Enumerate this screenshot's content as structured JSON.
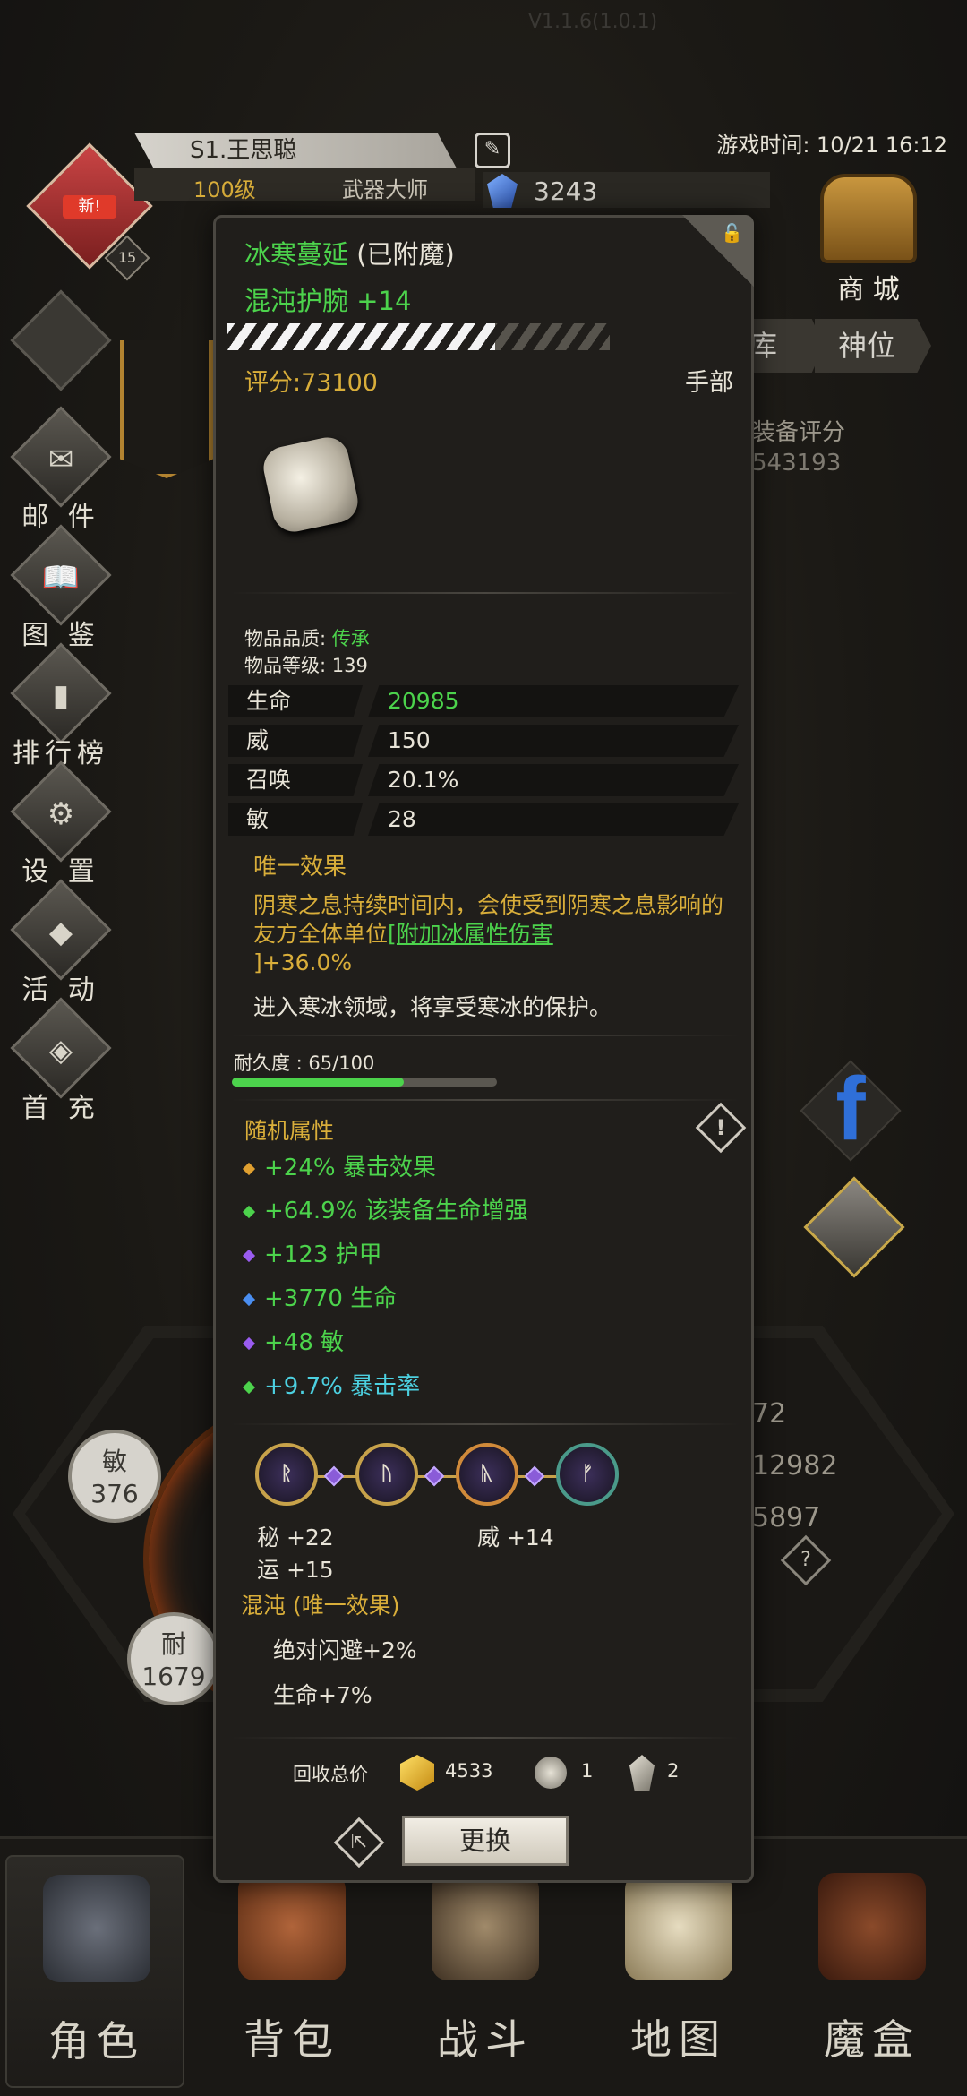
{
  "header": {
    "version": "V1.1.6(1.0.1)",
    "game_time": "游戏时间: 10/21 16:12",
    "avatar_badge": "新!",
    "avatar_level": "15",
    "player_name": "S1.王思聪",
    "player_level": "100级",
    "player_class": "武器大师",
    "gems": "3243",
    "shop_label": "商 城"
  },
  "right_tabs": [
    "库",
    "神位"
  ],
  "right_rating": {
    "label": "装备评分",
    "value": "543193"
  },
  "left_nav": [
    {
      "label": "邮 件",
      "icon": "mail-icon",
      "glyph": "✉"
    },
    {
      "label": "图 鉴",
      "icon": "book-icon",
      "glyph": "📖"
    },
    {
      "label": "排行榜",
      "icon": "leaderboard-icon",
      "glyph": "▮"
    },
    {
      "label": "设 置",
      "icon": "gear-icon",
      "glyph": "⚙"
    },
    {
      "label": "活 动",
      "icon": "event-icon",
      "glyph": "◆"
    },
    {
      "label": "首 充",
      "icon": "first-recharge-icon",
      "glyph": "◈"
    }
  ],
  "bg_stats": {
    "agility": {
      "label": "敏",
      "value": "376"
    },
    "durability": {
      "label": "耐",
      "value": "1679"
    },
    "right_values": [
      "72",
      "12982",
      "5897"
    ]
  },
  "bottom_nav": [
    {
      "label": "角色",
      "icon": "helmet-icon"
    },
    {
      "label": "背包",
      "icon": "backpack-icon"
    },
    {
      "label": "战斗",
      "icon": "sword-icon"
    },
    {
      "label": "地图",
      "icon": "scroll-map-icon"
    },
    {
      "label": "魔盒",
      "icon": "magic-box-icon"
    }
  ],
  "item": {
    "name": "冰寒蔓延",
    "name_suffix": "(已附魔)",
    "subtitle": "混沌护腕 +14",
    "enchant_progress": 0.7,
    "score": "评分:73100",
    "slot": "手部",
    "quality_label": "物品品质:",
    "quality_value": "传承",
    "level_line": "物品等级: 139",
    "stats": [
      {
        "key": "生命",
        "value": "20985",
        "green": true
      },
      {
        "key": "威",
        "value": "150",
        "green": false
      },
      {
        "key": "召唤",
        "value": "20.1%",
        "green": false
      },
      {
        "key": "敏",
        "value": "28",
        "green": false
      }
    ],
    "unique_title": "唯一效果",
    "unique_desc_1": "阴寒之息持续时间内，会使受到阴寒之息影响的友方全体单位",
    "unique_desc_link": "[附加冰属性伤害",
    "unique_desc_2": "]+36.0%",
    "unique_note": "进入寒冰领域，将享受寒冰的保护。",
    "durability_label": "耐久度 : 65/100",
    "durability_ratio": 0.65,
    "random_title": "随机属性",
    "random_attrs": [
      {
        "text": "+24% 暴击效果",
        "color": "#4cd34c",
        "dot": "#e0a030"
      },
      {
        "text": "+64.9% 该装备生命增强",
        "color": "#4cd34c",
        "dot": "#4cd34c"
      },
      {
        "text": "+123 护甲",
        "color": "#4cd34c",
        "dot": "#9a5cf0"
      },
      {
        "text": "+3770 生命",
        "color": "#4cd34c",
        "dot": "#4a8ef0"
      },
      {
        "text": "+48 敏",
        "color": "#4cd34c",
        "dot": "#9a5cf0"
      },
      {
        "text": "+9.7% 暴击率",
        "color": "#4cd0e0",
        "dot": "#4cd34c"
      }
    ],
    "sockets": [
      "ᚱ",
      "ᚢ",
      "ᚣ",
      "ᚠ"
    ],
    "socket_bonus": {
      "b1": "秘 +22",
      "b2": "运 +15",
      "b3": "威 +14"
    },
    "chaos_title": "混沌 (唯一效果)",
    "chaos_lines": [
      "绝对闪避+2%",
      "生命+7%"
    ],
    "recycle_label": "回收总价",
    "recycle_gold": "4533",
    "recycle_shard1": "1",
    "recycle_shard2": "2",
    "swap_button": "更换"
  }
}
